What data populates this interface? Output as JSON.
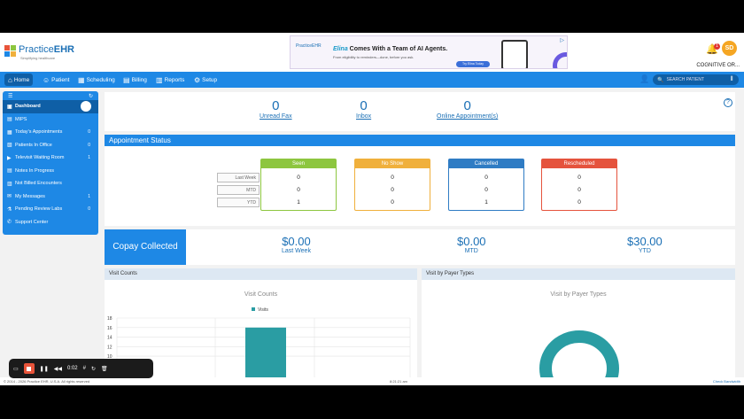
{
  "header": {
    "logo": {
      "brand_a": "Practice",
      "brand_b": "EHR",
      "tagline": "Simplifying healthcare"
    },
    "ad": {
      "logo": "PracticeEHR",
      "headline_brand": "Elina",
      "headline_rest": " Comes With a Team of AI Agents.",
      "subtitle": "From eligibility to reminders—done, before you ask.",
      "cta": "Try Elina Today"
    },
    "notification_count": "1",
    "avatar_initials": "SD",
    "user_label": "COGNITIVE OR..."
  },
  "nav": {
    "items": [
      {
        "label": "Home",
        "icon": "home-icon"
      },
      {
        "label": "Patient",
        "icon": "person-icon"
      },
      {
        "label": "Scheduling",
        "icon": "calendar-icon"
      },
      {
        "label": "Billing",
        "icon": "billing-icon"
      },
      {
        "label": "Reports",
        "icon": "reports-icon"
      },
      {
        "label": "Setup",
        "icon": "setup-icon"
      }
    ],
    "search_placeholder": "SEARCH PATIENT"
  },
  "sidebar": {
    "items": [
      {
        "label": "Dashboard",
        "count": ""
      },
      {
        "label": "MIPS",
        "count": ""
      },
      {
        "label": "Today's Appointments",
        "count": "0"
      },
      {
        "label": "Patients In Office",
        "count": "0"
      },
      {
        "label": "Televisit Waiting Room",
        "count": "1"
      },
      {
        "label": "Notes In Progress",
        "count": ""
      },
      {
        "label": "Not Billed Encounters",
        "count": ""
      },
      {
        "label": "My Messages",
        "count": "1"
      },
      {
        "label": "Pending Review Labs",
        "count": "0"
      },
      {
        "label": "Support Center",
        "count": ""
      }
    ]
  },
  "summary": [
    {
      "value": "0",
      "label": "Unread Fax"
    },
    {
      "value": "0",
      "label": "Inbox"
    },
    {
      "value": "0",
      "label": "Online Appointment(s)"
    }
  ],
  "appointment_status": {
    "title": "Appointment Status",
    "row_labels": [
      "Last Week",
      "MTD",
      "YTD"
    ],
    "cards": [
      {
        "title": "Seen",
        "color": "#8dc63f",
        "values": [
          "0",
          "0",
          "1"
        ]
      },
      {
        "title": "No Show",
        "color": "#f0b03c",
        "values": [
          "0",
          "0",
          "0"
        ]
      },
      {
        "title": "Cancelled",
        "color": "#2f7cc4",
        "values": [
          "0",
          "0",
          "1"
        ]
      },
      {
        "title": "Rescheduled",
        "color": "#e5533d",
        "values": [
          "0",
          "0",
          "0"
        ]
      }
    ]
  },
  "copay": {
    "title": "Copay Collected",
    "blocks": [
      {
        "amount": "$0.00",
        "label": "Last Week"
      },
      {
        "amount": "$0.00",
        "label": "MTD"
      },
      {
        "amount": "$30.00",
        "label": "YTD"
      }
    ]
  },
  "visit_counts": {
    "panel_title": "Visit Counts",
    "chart_data": {
      "type": "bar",
      "title": "Visit Counts",
      "legend": [
        "Visits"
      ],
      "series": [
        {
          "name": "Visits",
          "values": [
            16
          ]
        }
      ],
      "ylim": [
        0,
        18
      ],
      "yticks": [
        "18",
        "16",
        "14",
        "12",
        "10"
      ],
      "color": "#2a9da3"
    }
  },
  "payer_types": {
    "panel_title": "Visit by Payer Types",
    "chart_title": "Visit by Payer Types",
    "color": "#2a9da3"
  },
  "footer": {
    "copyright": "© 2014 - 2026 Practice EHR, U.S.A. All rights reserved",
    "time": "8:21:21 am",
    "right": "Check Bandwidth"
  },
  "recorder": {
    "timer": "0:02"
  }
}
